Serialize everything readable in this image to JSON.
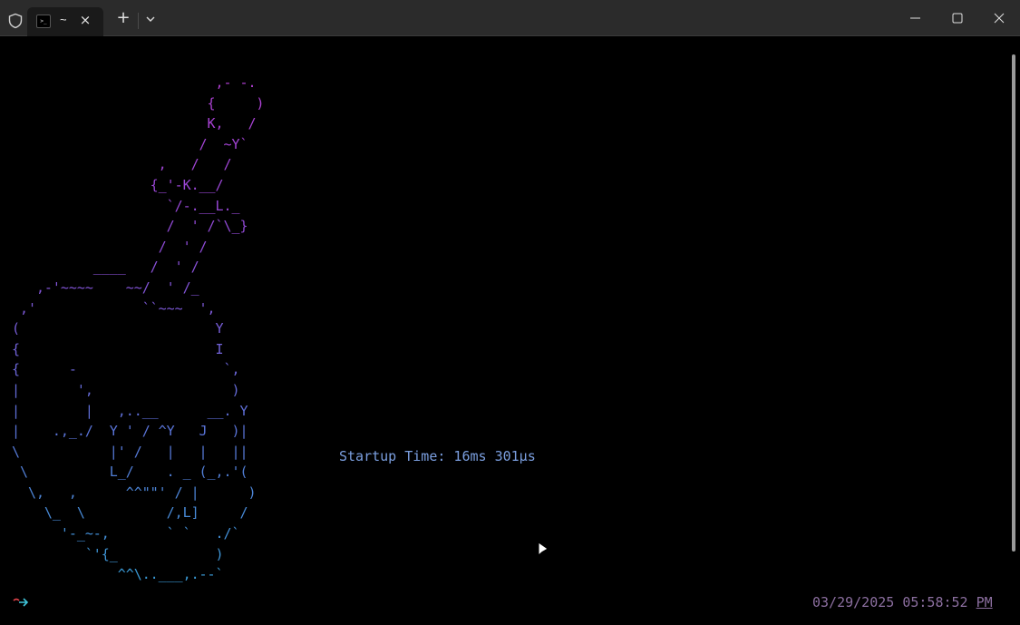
{
  "titlebar": {
    "tab_title": "~",
    "tab_icon_text": ">_",
    "new_tab_label": "+",
    "tab_close_label": "×"
  },
  "colors": {
    "titlebar_bg": "#2b2b2b",
    "terminal_bg": "#000000",
    "art_gradient": [
      "#b13fd3",
      "#8e4bd7",
      "#5f6fd8",
      "#3a9ad6"
    ],
    "startup_text": "#7b9fe0",
    "clock_text": "#8c6fa0",
    "prompt_arrow_red": "#e0434a",
    "prompt_arrow_cyan": "#3fc3d8"
  },
  "icons": {
    "shield": "shield-icon",
    "tab_icon": "terminal-icon",
    "dropdown": "chevron-down-icon",
    "minimize": "minimize-icon",
    "maximize": "maximize-icon",
    "close": "close-icon",
    "prompt": "prompt-arrow-icon",
    "cursor": "mouse-pointer-icon"
  },
  "terminal": {
    "ascii_art": [
      "                         ,- -.",
      "                        {     )",
      "                        K,   /",
      "                       /  ~Y`",
      "                  ,   /   /",
      "                 {_'-K.__/",
      "                   `/-.__L._",
      "                   /  ' /`\\_}",
      "                  /  ' /",
      "          ____   /  ' /",
      "   ,-'~~~~    ~~/  ' /_",
      " ,'             ``~~~  ',",
      "(                        Y",
      "{                        I",
      "{      -                  `,",
      "|       ',                 )",
      "|        |   ,..__      __. Y",
      "|    .,_./  Y ' / ^Y   J   )|",
      "\\           |' /   |   |   ||",
      " \\          L_/    . _ (_,.'(",
      "  \\,   ,      ^^\"\"' / |      )",
      "    \\_  \\          /,L]     /",
      "      '-_~-,       ` `   ./`",
      "         `'{_            )",
      "             ^^\\..___,.--`"
    ],
    "startup_label": "Startup Time: 16ms 301µs",
    "clock_date": "03/29/2025",
    "clock_time": "05:58:52",
    "clock_ampm": "PM"
  }
}
